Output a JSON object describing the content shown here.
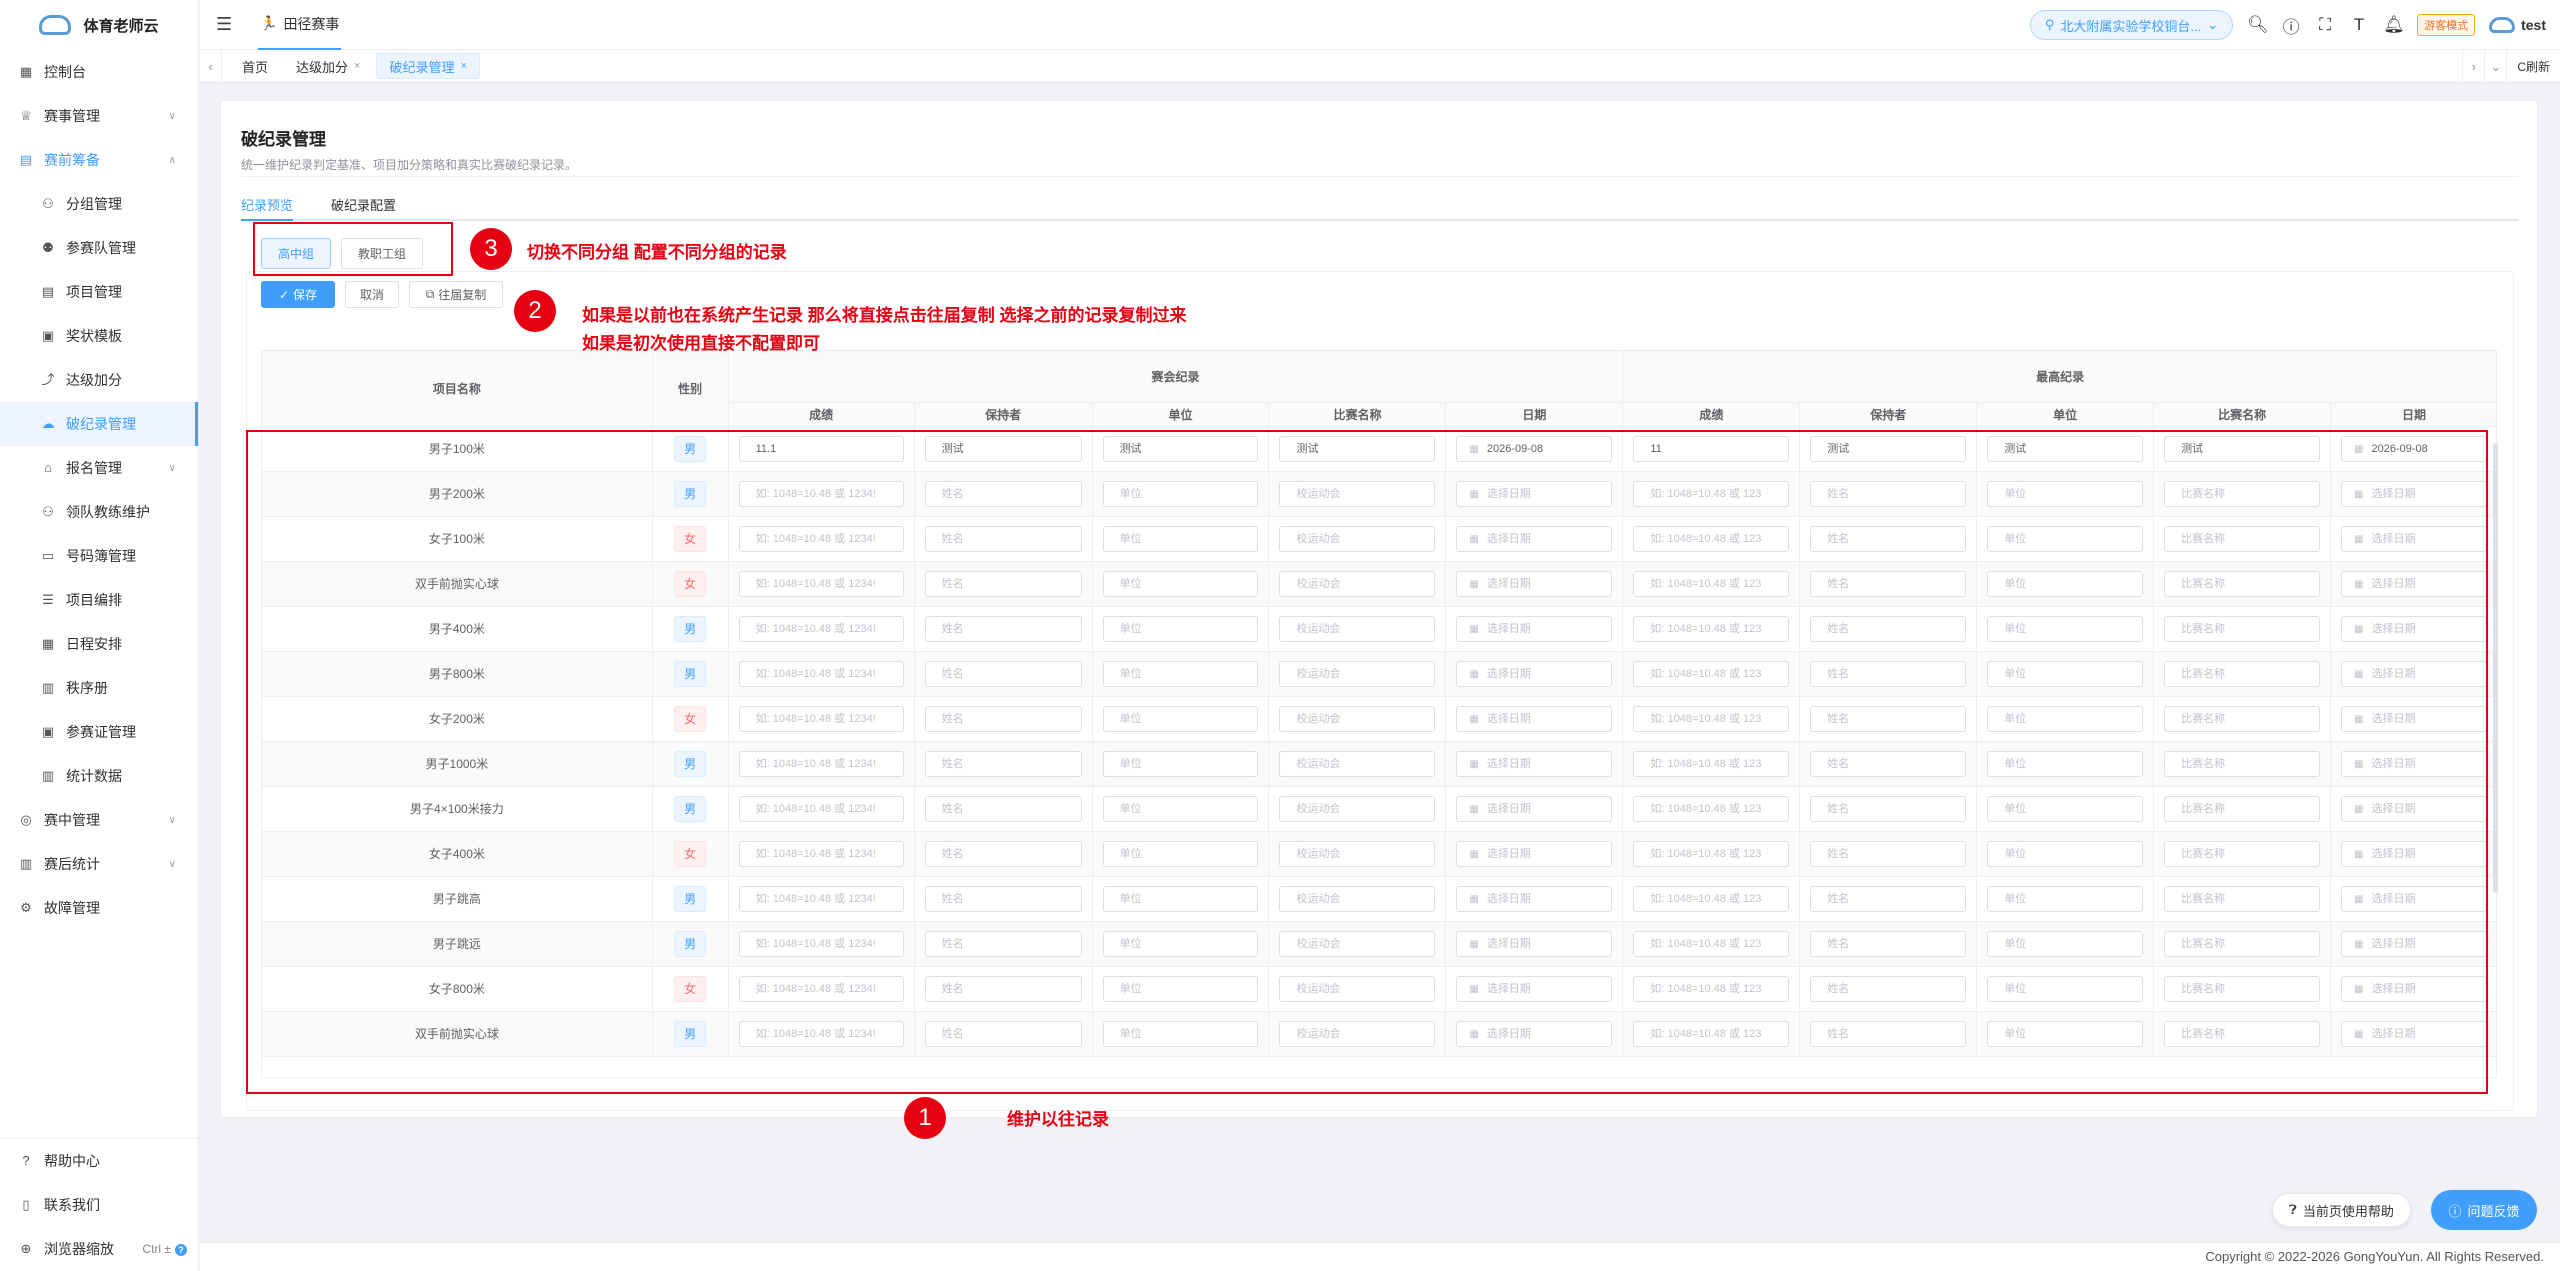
{
  "app": {
    "name": "体育老师云",
    "user": "test",
    "school": "北大附属实验学校铜台...",
    "mode_badge": "游客模式",
    "top_tab": "田径赛事"
  },
  "sidebar": {
    "items": [
      {
        "label": "控制台",
        "icon": "dashboard-icon",
        "kind": "top",
        "arrow": ""
      },
      {
        "label": "赛事管理",
        "icon": "trophy-icon",
        "kind": "top",
        "arrow": "∨"
      },
      {
        "label": "赛前筹备",
        "icon": "clipboard-icon",
        "kind": "open",
        "arrow": "∧"
      },
      {
        "label": "分组管理",
        "icon": "group-icon",
        "kind": "sub",
        "arrow": ""
      },
      {
        "label": "参赛队管理",
        "icon": "team-icon",
        "kind": "sub",
        "arrow": ""
      },
      {
        "label": "项目管理",
        "icon": "doc-icon",
        "kind": "sub",
        "arrow": ""
      },
      {
        "label": "奖状模板",
        "icon": "certificate-icon",
        "kind": "sub",
        "arrow": ""
      },
      {
        "label": "达级加分",
        "icon": "chart-icon",
        "kind": "sub",
        "arrow": ""
      },
      {
        "label": "破纪录管理",
        "icon": "record-icon",
        "kind": "active",
        "arrow": ""
      },
      {
        "label": "报名管理",
        "icon": "register-icon",
        "kind": "sub",
        "arrow": "∨"
      },
      {
        "label": "领队教练维护",
        "icon": "coach-icon",
        "kind": "sub",
        "arrow": ""
      },
      {
        "label": "号码簿管理",
        "icon": "bib-icon",
        "kind": "sub",
        "arrow": ""
      },
      {
        "label": "项目编排",
        "icon": "arrange-icon",
        "kind": "sub",
        "arrow": ""
      },
      {
        "label": "日程安排",
        "icon": "calendar-icon",
        "kind": "sub",
        "arrow": ""
      },
      {
        "label": "秩序册",
        "icon": "book-icon",
        "kind": "sub",
        "arrow": ""
      },
      {
        "label": "参赛证管理",
        "icon": "badge-icon",
        "kind": "sub",
        "arrow": ""
      },
      {
        "label": "统计数据",
        "icon": "stats-icon",
        "kind": "sub",
        "arrow": ""
      },
      {
        "label": "赛中管理",
        "icon": "target-icon",
        "kind": "top",
        "arrow": "∨"
      },
      {
        "label": "赛后统计",
        "icon": "bar-icon",
        "kind": "top",
        "arrow": "∨"
      },
      {
        "label": "故障管理",
        "icon": "gear-icon",
        "kind": "top",
        "arrow": ""
      }
    ],
    "bottom": [
      {
        "label": "帮助中心",
        "icon": "help-icon"
      },
      {
        "label": "联系我们",
        "icon": "phone-icon"
      },
      {
        "label": "浏览器缩放",
        "icon": "zoom-icon",
        "hint": "Ctrl ±"
      }
    ]
  },
  "tags": [
    {
      "label": "首页",
      "closable": false,
      "active": false
    },
    {
      "label": "达级加分",
      "closable": true,
      "active": false
    },
    {
      "label": "破纪录管理",
      "closable": true,
      "active": true
    }
  ],
  "tagsbar": {
    "refresh": "C刷新"
  },
  "page": {
    "title": "破纪录管理",
    "desc": "统一维护纪录判定基准、项目加分策略和真实比赛破纪录记录。",
    "tabs": [
      "纪录预览",
      "破纪录配置"
    ],
    "groups": [
      "高中组",
      "教职工组"
    ],
    "buttons": {
      "save": "保存",
      "cancel": "取消",
      "copy": "往届复制"
    }
  },
  "table": {
    "col_name": "项目名称",
    "col_gender": "性别",
    "group_meet": "赛会纪录",
    "group_best": "最高纪录",
    "sub_cols": [
      "成绩",
      "保持者",
      "单位",
      "比赛名称",
      "日期"
    ],
    "placeholders": {
      "score_a": "如: 1048=10.48 或 1234!",
      "score_b": "如: 1048=10.48 或 123",
      "holder": "姓名",
      "unit": "单位",
      "meet_a": "校运动会",
      "meet_b": "比赛名称",
      "date": "选择日期"
    },
    "rows": [
      {
        "name": "男子100米",
        "gender": "男",
        "meet": [
          "11.1",
          "测试",
          "测试",
          "测试",
          "2026-09-08"
        ],
        "best": [
          "11",
          "测试",
          "测试",
          "测试",
          "2026-09-08"
        ]
      },
      {
        "name": "男子200米",
        "gender": "男"
      },
      {
        "name": "女子100米",
        "gender": "女"
      },
      {
        "name": "双手前抛实心球",
        "gender": "女"
      },
      {
        "name": "男子400米",
        "gender": "男"
      },
      {
        "name": "男子800米",
        "gender": "男"
      },
      {
        "name": "女子200米",
        "gender": "女"
      },
      {
        "name": "男子1000米",
        "gender": "男"
      },
      {
        "name": "男子4×100米接力",
        "gender": "男"
      },
      {
        "name": "女子400米",
        "gender": "女"
      },
      {
        "name": "男子跳高",
        "gender": "男"
      },
      {
        "name": "男子跳远",
        "gender": "男"
      },
      {
        "name": "女子800米",
        "gender": "女"
      },
      {
        "name": "双手前抛实心球",
        "gender": "男"
      }
    ]
  },
  "annotations": {
    "n1": "1",
    "n2": "2",
    "n3": "3",
    "t1": "维护以往记录",
    "t2a": "如果是以前也在系统产生记录 那么将直接点击往届复制 选择之前的记录复制过来",
    "t2b": "如果是初次使用直接不配置即可",
    "t3": "切换不同分组 配置不同分组的记录",
    "color": "#e60012"
  },
  "footer": {
    "copyright": "Copyright © 2022-2026 GongYouYun. All Rights Reserved.",
    "help": "当前页使用帮助",
    "feedback": "问题反馈"
  }
}
